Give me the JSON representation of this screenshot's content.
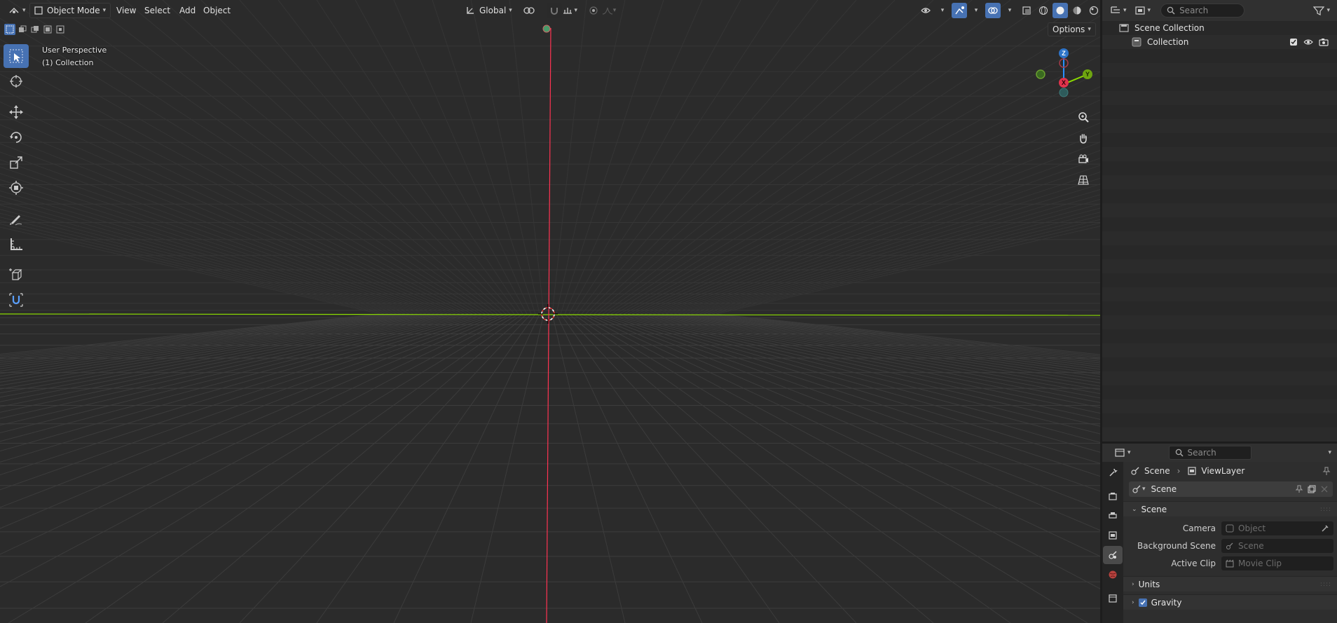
{
  "header": {
    "mode": "Object Mode",
    "menus": [
      "View",
      "Select",
      "Add",
      "Object"
    ],
    "transform_orientation": "Global",
    "options": "Options"
  },
  "viewport": {
    "perspective": "User Perspective",
    "collection": "(1) Collection",
    "gizmo_axes": {
      "z": "Z",
      "y": "Y",
      "x": "X"
    }
  },
  "outliner": {
    "search_placeholder": "Search",
    "items": [
      {
        "label": "Scene Collection"
      },
      {
        "label": "Collection"
      }
    ]
  },
  "properties": {
    "search_placeholder": "Search",
    "breadcrumb": {
      "scene": "Scene",
      "view_layer": "ViewLayer"
    },
    "scene_selector": "Scene",
    "panels": {
      "scene": {
        "title": "Scene",
        "rows": [
          {
            "label": "Camera",
            "placeholder": "Object"
          },
          {
            "label": "Background Scene",
            "placeholder": "Scene"
          },
          {
            "label": "Active Clip",
            "placeholder": "Movie Clip"
          }
        ]
      },
      "units": {
        "title": "Units"
      },
      "gravity": {
        "title": "Gravity"
      }
    }
  },
  "colors": {
    "accent": "#4772b3",
    "x_axis": "#ff3352",
    "y_axis": "#8bdc00",
    "z_axis": "#2890ff",
    "grid": "#3c3c3c"
  }
}
